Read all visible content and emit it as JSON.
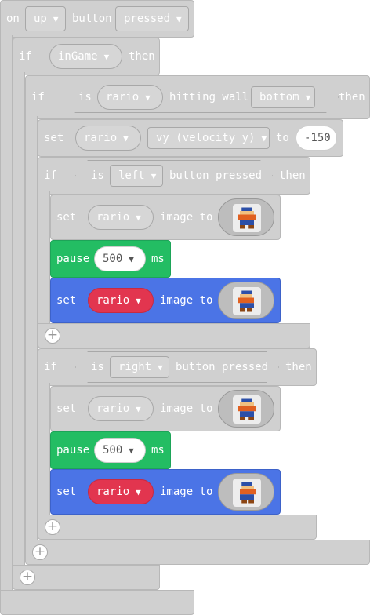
{
  "event": {
    "on": "on",
    "button": "up",
    "button_word": "button",
    "state": "pressed"
  },
  "if1": {
    "if": "if",
    "cond": "inGame",
    "then": "then"
  },
  "if2": {
    "if": "if",
    "is": "is",
    "sprite": "rario",
    "hitting": "hitting wall",
    "wall": "bottom",
    "then": "then"
  },
  "set_vy": {
    "set": "set",
    "sprite": "rario",
    "prop": "vy (velocity y)",
    "to": "to",
    "value": "-150"
  },
  "if_left": {
    "if": "if",
    "is": "is",
    "dir": "left",
    "pressed": "button pressed",
    "then": "then"
  },
  "left_set1": {
    "set": "set",
    "sprite": "rario",
    "image_to": "image to"
  },
  "left_pause": {
    "pause": "pause",
    "ms_value": "500",
    "ms": "ms"
  },
  "left_set2": {
    "set": "set",
    "sprite": "rario",
    "image_to": "image to"
  },
  "if_right": {
    "if": "if",
    "is": "is",
    "dir": "right",
    "pressed": "button pressed",
    "then": "then"
  },
  "right_set1": {
    "set": "set",
    "sprite": "rario",
    "image_to": "image to"
  },
  "right_pause": {
    "pause": "pause",
    "ms_value": "500",
    "ms": "ms"
  },
  "right_set2": {
    "set": "set",
    "sprite": "rario",
    "image_to": "image to"
  },
  "icons": {
    "caret": "▼",
    "plus": "+"
  }
}
